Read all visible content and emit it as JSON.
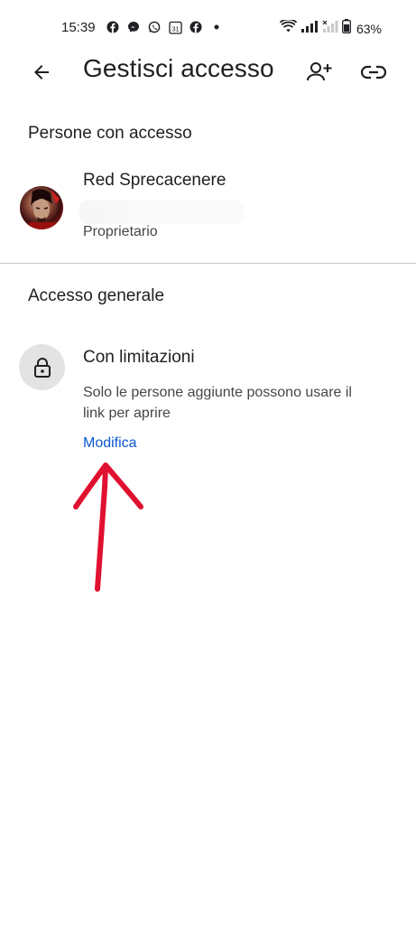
{
  "status_bar": {
    "time": "15:39",
    "calendar_day": "31",
    "battery": "63%",
    "icons": [
      "facebook-icon",
      "messenger-icon",
      "whatsapp-icon",
      "calendar-icon",
      "facebook-icon",
      "more-dot-icon",
      "wifi-icon",
      "signal-icon",
      "signal-no-service-icon",
      "battery-icon"
    ]
  },
  "app_bar": {
    "title": "Gestisci accesso",
    "icons": [
      "back-arrow-icon",
      "add-person-icon",
      "link-icon"
    ]
  },
  "people_section": {
    "heading": "Persone con accesso",
    "people": [
      {
        "name": "Red Sprecacenere",
        "role": "Proprietario"
      }
    ]
  },
  "general_access": {
    "heading": "Accesso generale",
    "title": "Con limitazioni",
    "description": "Solo le persone aggiunte possono usare il link per aprire",
    "action_label": "Modifica",
    "icon": "lock-icon"
  },
  "colors": {
    "accent": "#0b57d0",
    "annotation_arrow": "#e01030",
    "lock_bg": "#e3e3e3"
  }
}
